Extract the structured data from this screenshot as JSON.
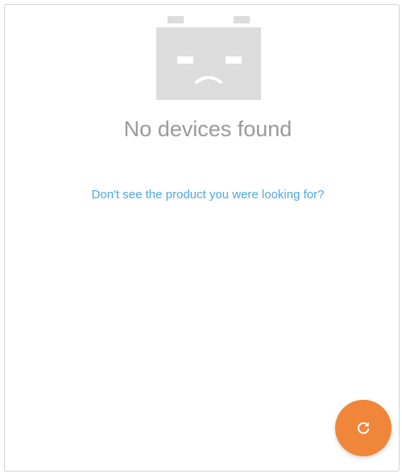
{
  "empty_state": {
    "illustration_icon": "sad-battery-icon",
    "title": "No devices found",
    "help_link": "Don't see the product you were looking for?"
  },
  "fab": {
    "icon": "refresh-icon",
    "color": "#f0863a"
  },
  "colors": {
    "title_text": "#9a9a9a",
    "link_text": "#4fa8e0",
    "illustration": "#dcdcdc"
  }
}
